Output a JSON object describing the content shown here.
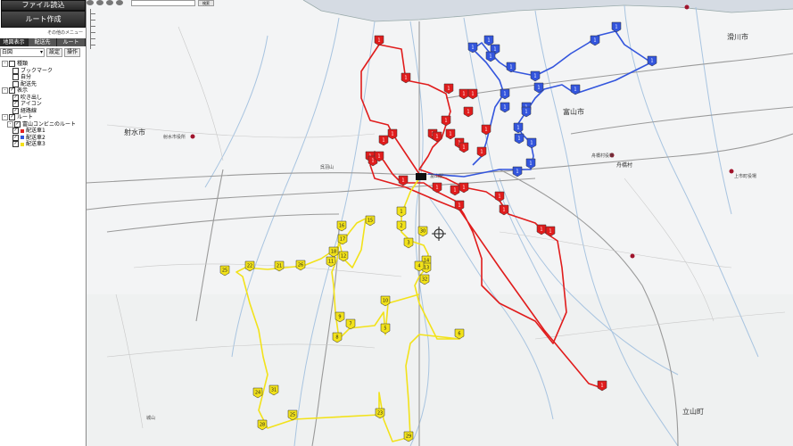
{
  "sidebar": {
    "file_read_button": "ファイル読込",
    "route_create_button": "ルート作成",
    "other_menu": "その他のメニュー",
    "tabs": [
      "地図表示",
      "配送先",
      "ルート"
    ],
    "map_select": "白図",
    "settings_label": "設定",
    "operations_label": "操作",
    "tree": [
      {
        "label": "種類",
        "indent": 0,
        "expander": "-",
        "checked": false
      },
      {
        "label": "ブックマーク",
        "indent": 2,
        "checked": false
      },
      {
        "label": "自分",
        "indent": 2,
        "checked": false
      },
      {
        "label": "配送先",
        "indent": 2,
        "checked": false
      },
      {
        "label": "表示",
        "indent": 0,
        "expander": "-",
        "checked": true
      },
      {
        "label": "吹き出し",
        "indent": 2,
        "checked": true
      },
      {
        "label": "アイコン",
        "indent": 2,
        "checked": true
      },
      {
        "label": "経路線",
        "indent": 2,
        "checked": true
      },
      {
        "label": "ルート",
        "indent": 0,
        "expander": "-",
        "checked": true
      },
      {
        "label": "富山コンビニのルート",
        "indent": 1,
        "expander": "-",
        "checked": true
      },
      {
        "label": "配送車1",
        "indent": 2,
        "checked": true,
        "color": "#e22020"
      },
      {
        "label": "配送車2",
        "indent": 2,
        "checked": true,
        "color": "#3355dd"
      },
      {
        "label": "配送車3",
        "indent": 2,
        "checked": true,
        "color": "#f4e01a"
      }
    ]
  },
  "map": {
    "search_button": "検索",
    "place_labels": {
      "imizu": "射水市",
      "toyama": "富山市",
      "namerikawa": "滑川市",
      "funahashi": "舟橋村",
      "tateyama": "立山町",
      "toyama_station": "富山駅",
      "imizu_office": "射水市役所",
      "funahashi_office": "舟橋村役場",
      "kamiichi_office": "上市町役場",
      "kureha": "呉羽山",
      "mt_small": "城山"
    },
    "colors": {
      "route1": "#e01c1c",
      "route2": "#3355dd",
      "route3": "#f2e21a",
      "sea": "#d5dbe3",
      "river": "#a8c4e0"
    },
    "route1_stops": [
      "1",
      "1",
      "1",
      "1",
      "1",
      "1",
      "1",
      "1",
      "1",
      "1",
      "1",
      "1",
      "1",
      "1",
      "1",
      "1",
      "1",
      "1",
      "1",
      "1",
      "1",
      "1",
      "1",
      "1",
      "1",
      "1",
      "1",
      "1",
      "1"
    ],
    "route2_stops": [
      "1",
      "1",
      "1",
      "1",
      "1",
      "1",
      "1",
      "1",
      "1",
      "1",
      "1",
      "1",
      "1",
      "1",
      "1",
      "1",
      "1",
      "1",
      "1",
      "1"
    ],
    "route3_stops": [
      "1",
      "15",
      "2",
      "16",
      "17",
      "3",
      "30",
      "18",
      "11",
      "12",
      "14",
      "13",
      "32",
      "4",
      "22",
      "21",
      "25",
      "26",
      "10",
      "5",
      "9",
      "7",
      "8",
      "6",
      "31",
      "24",
      "25",
      "23",
      "28",
      "29",
      "30"
    ]
  }
}
